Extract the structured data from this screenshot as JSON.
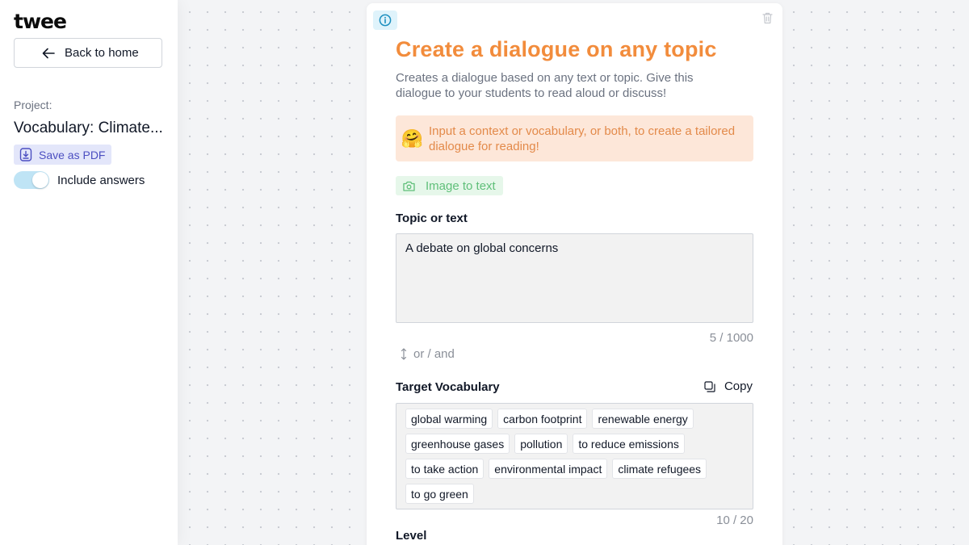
{
  "app": {
    "logo": "twee"
  },
  "sidebar": {
    "back_label": "Back to home",
    "project_label": "Project:",
    "project_name": "Vocabulary: Climate...",
    "save_pdf_label": "Save as PDF",
    "include_answers_label": "Include answers",
    "include_answers_on": true
  },
  "card": {
    "title": "Create a dialogue on any topic",
    "subtitle": "Creates a dialogue based on any text or topic. Give this dialogue to your students to read aloud or discuss!",
    "hint_emoji": "🤗",
    "hint_text": "Input a context or vocabulary, or both, to create a tailored dialogue for reading!",
    "image_to_text_label": "Image to text",
    "topic_label": "Topic or text",
    "topic_value": "A debate on global concerns",
    "topic_counter": "5 / 1000",
    "or_and_label": "or / and",
    "vocab_label": "Target Vocabulary",
    "copy_label": "Copy",
    "vocab_rows": [
      [
        "global warming",
        "carbon footprint",
        "renewable energy"
      ],
      [
        "greenhouse gases",
        "pollution",
        "to reduce emissions"
      ],
      [
        "to take action",
        "environmental impact",
        "climate refugees"
      ],
      [
        "to go green"
      ]
    ],
    "vocab_counter": "10 / 20",
    "level_label": "Level"
  },
  "colors": {
    "accent_orange": "#f28c3c",
    "pdf_blue": "#4c4fc1",
    "image_green": "#5fbf79",
    "toggle_blue": "#bfe4f5"
  },
  "icons": {
    "back": "arrow-left-icon",
    "pdf": "file-download-icon",
    "info": "info-icon",
    "trash": "trash-icon",
    "camera": "camera-icon",
    "or_and": "updown-arrow-icon",
    "copy": "copy-icon"
  }
}
